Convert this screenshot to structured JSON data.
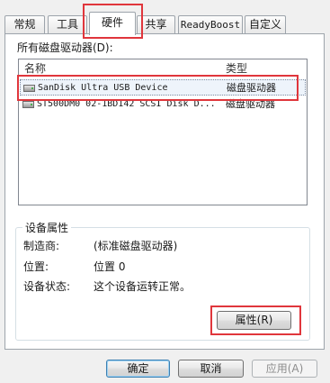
{
  "tabs": [
    {
      "label": "常规"
    },
    {
      "label": "工具"
    },
    {
      "label": "硬件",
      "active": true
    },
    {
      "label": "共享"
    },
    {
      "label": "ReadyBoost"
    },
    {
      "label": "自定义"
    }
  ],
  "disk_section": {
    "label": "所有磁盘驱动器(D):",
    "columns": {
      "name": "名称",
      "type": "类型"
    },
    "rows": [
      {
        "name": "SanDisk Ultra USB Device",
        "type": "磁盘驱动器",
        "icon": "drive-icon",
        "selected": true
      },
      {
        "name": "ST500DM0 02-1BD142 SCSI Disk D...",
        "type": "磁盘驱动器",
        "icon": "drive-icon",
        "selected": false
      }
    ]
  },
  "device_properties": {
    "legend": "设备属性",
    "manufacturer_label": "制造商:",
    "manufacturer_value": "(标准磁盘驱动器)",
    "location_label": "位置:",
    "location_value": "位置 0",
    "status_label": "设备状态:",
    "status_value": "这个设备运转正常。",
    "properties_button": "属性(R)"
  },
  "footer": {
    "ok": "确定",
    "cancel": "取消",
    "apply": "应用(A)"
  },
  "highlight_color": "#e0363c"
}
